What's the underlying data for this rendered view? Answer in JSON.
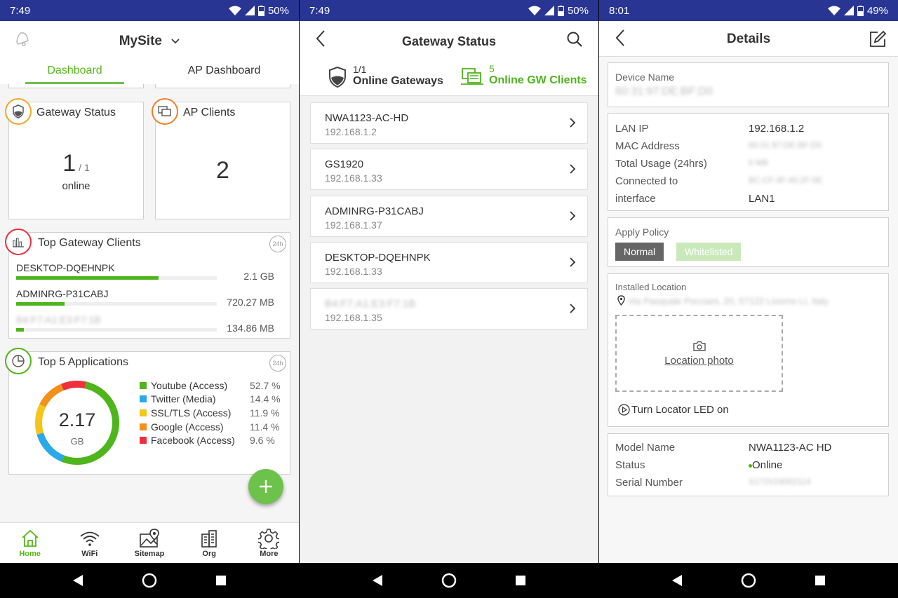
{
  "screen1": {
    "status": {
      "time": "7:49",
      "battery": "50%"
    },
    "site": "MySite",
    "tabs": [
      "Dashboard",
      "AP Dashboard"
    ],
    "gateway_status": {
      "title": "Gateway Status",
      "online": "1",
      "total": "/ 1",
      "label": "online"
    },
    "ap_clients": {
      "title": "AP Clients",
      "count": "2"
    },
    "top_clients": {
      "title": "Top Gateway Clients",
      "badge": "24h",
      "rows": [
        {
          "name": "DESKTOP-DQEHNPK",
          "size": "2.1 GB",
          "fraction": 0.71
        },
        {
          "name": "ADMINRG-P31CABJ",
          "size": "720.27 MB",
          "fraction": 0.24
        },
        {
          "name": "B4:F7:A1:E3:F7:1B",
          "size": "134.86 MB",
          "fraction": 0.04
        }
      ]
    },
    "top_apps": {
      "title": "Top 5 Applications",
      "badge": "24h",
      "total": "2.17",
      "unit": "GB",
      "items": [
        {
          "label": "Youtube (Access)",
          "pct": "52.7 %",
          "value": 52.7,
          "color": "#4eb51b"
        },
        {
          "label": "Twitter (Media)",
          "pct": "14.4 %",
          "value": 14.4,
          "color": "#29a9e8"
        },
        {
          "label": "SSL/TLS (Access)",
          "pct": "11.9 %",
          "value": 11.9,
          "color": "#f5c518"
        },
        {
          "label": "Google (Access)",
          "pct": "11.4 %",
          "value": 11.4,
          "color": "#f39019"
        },
        {
          "label": "Facebook (Access)",
          "pct": "9.6 %",
          "value": 9.6,
          "color": "#ee2f3c"
        }
      ]
    },
    "bottom_nav": [
      "Home",
      "WiFi",
      "Sitemap",
      "Org",
      "More"
    ]
  },
  "screen2": {
    "status": {
      "time": "7:49",
      "battery": "50%"
    },
    "title": "Gateway Status",
    "online_gateways": {
      "count": "1/1",
      "label": "Online Gateways"
    },
    "online_clients": {
      "count": "5",
      "label": "Online GW Clients"
    },
    "items": [
      {
        "name": "NWA1123-AC-HD",
        "ip": "192.168.1.2"
      },
      {
        "name": "GS1920",
        "ip": "192.168.1.33"
      },
      {
        "name": "ADMINRG-P31CABJ",
        "ip": "192.168.1.37"
      },
      {
        "name": "DESKTOP-DQEHNPK",
        "ip": "192.168.1.33"
      },
      {
        "name": "B4:F7:A1:E3:F7:1B",
        "ip": "192.168.1.35"
      }
    ]
  },
  "screen3": {
    "status": {
      "time": "8:01",
      "battery": "49%"
    },
    "title": "Details",
    "device_name_label": "Device Name",
    "device_name": "60:31:97:DE:BF:D0",
    "lan_ip_label": "LAN IP",
    "lan_ip": "192.168.1.2",
    "mac_label": "MAC Address",
    "mac": "60:31:97:DE:BF:D0",
    "usage_label": "Total Usage (24hrs)",
    "usage": "0 MB",
    "connected_label": "Connected to",
    "connected": "BC:CF:4F:40:2F:0E",
    "interface_label": "interface",
    "interface": "LAN1",
    "policy_label": "Apply Policy",
    "policy_normal": "Normal",
    "policy_whitelisted": "Whitelisted",
    "location_label": "Installed Location",
    "location": "Via Pasquale Pocciani, 20, 57122 Livorno LI, Italy",
    "photo_label": "Location photo",
    "locator": "Turn Locator LED on",
    "model_label": "Model Name",
    "model": "NWA1123-AC HD",
    "status_label": "Status",
    "status_value": "Online",
    "serial_label": "Serial Number",
    "serial": "S172V24002114"
  }
}
